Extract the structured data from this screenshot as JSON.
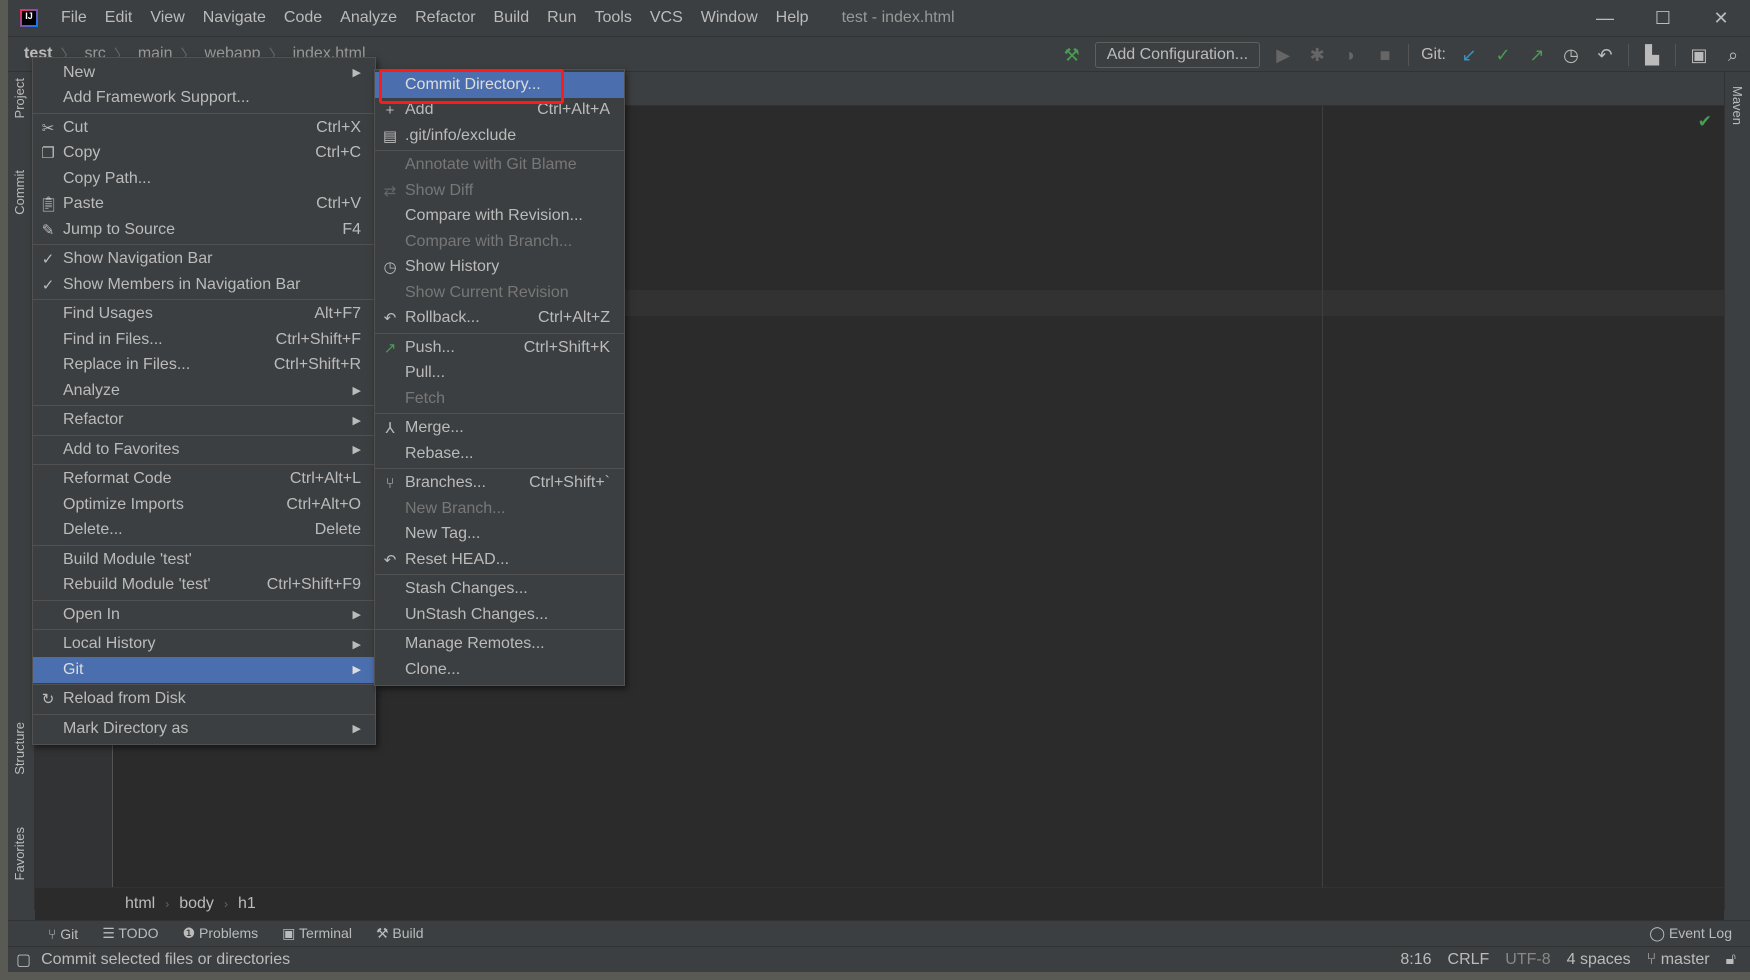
{
  "window": {
    "title": "test - index.html",
    "menu": [
      "File",
      "Edit",
      "View",
      "Navigate",
      "Code",
      "Analyze",
      "Refactor",
      "Build",
      "Run",
      "Tools",
      "VCS",
      "Window",
      "Help"
    ],
    "controls": {
      "minimize": "—",
      "maximize": "☐",
      "close": "✕"
    }
  },
  "navbar": {
    "crumbs": [
      "test",
      "src",
      "main",
      "webapp",
      "index.html"
    ],
    "add_configuration": "Add Configuration...",
    "git_label": "Git:"
  },
  "left_strip": [
    "Project",
    "Commit",
    "Structure",
    "Favorites"
  ],
  "right_strip": [
    "Maven"
  ],
  "editor_breadcrumb": [
    "html",
    "body",
    "h1"
  ],
  "tool_windows": [
    "Git",
    "TODO",
    "Problems",
    "Terminal",
    "Build"
  ],
  "event_log": "Event Log",
  "status": {
    "message": "Commit selected files or directories",
    "position": "8:16",
    "line_sep": "CRLF",
    "encoding": "UTF-8",
    "indent": "4 spaces",
    "branch": "master"
  },
  "context_menu": [
    {
      "label": "New",
      "submenu": true
    },
    {
      "label": "Add Framework Support..."
    },
    {
      "sep": true
    },
    {
      "label": "Cut",
      "shortcut": "Ctrl+X",
      "icon": "scissors"
    },
    {
      "label": "Copy",
      "shortcut": "Ctrl+C",
      "icon": "copy"
    },
    {
      "label": "Copy Path..."
    },
    {
      "label": "Paste",
      "shortcut": "Ctrl+V",
      "icon": "paste"
    },
    {
      "label": "Jump to Source",
      "shortcut": "F4",
      "icon": "pencil"
    },
    {
      "sep": true
    },
    {
      "label": "Show Navigation Bar",
      "icon": "check"
    },
    {
      "label": "Show Members in Navigation Bar",
      "icon": "check"
    },
    {
      "sep": true
    },
    {
      "label": "Find Usages",
      "shortcut": "Alt+F7"
    },
    {
      "label": "Find in Files...",
      "shortcut": "Ctrl+Shift+F"
    },
    {
      "label": "Replace in Files...",
      "shortcut": "Ctrl+Shift+R"
    },
    {
      "label": "Analyze",
      "submenu": true
    },
    {
      "sep": true
    },
    {
      "label": "Refactor",
      "submenu": true
    },
    {
      "sep": true
    },
    {
      "label": "Add to Favorites",
      "submenu": true
    },
    {
      "sep": true
    },
    {
      "label": "Reformat Code",
      "shortcut": "Ctrl+Alt+L"
    },
    {
      "label": "Optimize Imports",
      "shortcut": "Ctrl+Alt+O"
    },
    {
      "label": "Delete...",
      "shortcut": "Delete"
    },
    {
      "sep": true
    },
    {
      "label": "Build Module 'test'"
    },
    {
      "label": "Rebuild Module 'test'",
      "shortcut": "Ctrl+Shift+F9"
    },
    {
      "sep": true
    },
    {
      "label": "Open In",
      "submenu": true
    },
    {
      "sep": true
    },
    {
      "label": "Local History",
      "submenu": true
    },
    {
      "label": "Git",
      "submenu": true,
      "selected": true
    },
    {
      "sep": true
    },
    {
      "label": "Reload from Disk",
      "icon": "reload"
    },
    {
      "sep": true
    },
    {
      "label": "Mark Directory as",
      "submenu": true
    }
  ],
  "git_submenu": [
    {
      "label": "Commit Directory...",
      "selected": true
    },
    {
      "label": "Add",
      "shortcut": "Ctrl+Alt+A",
      "icon": "plus"
    },
    {
      "label": ".git/info/exclude",
      "icon": "file-ignore"
    },
    {
      "sep": true
    },
    {
      "label": "Annotate with Git Blame",
      "disabled": true
    },
    {
      "label": "Show Diff",
      "disabled": true,
      "icon": "diff"
    },
    {
      "label": "Compare with Revision..."
    },
    {
      "label": "Compare with Branch...",
      "disabled": true
    },
    {
      "label": "Show History",
      "icon": "clock"
    },
    {
      "label": "Show Current Revision",
      "disabled": true
    },
    {
      "label": "Rollback...",
      "shortcut": "Ctrl+Alt+Z",
      "icon": "undo"
    },
    {
      "sep": true
    },
    {
      "label": "Push...",
      "shortcut": "Ctrl+Shift+K",
      "icon": "push-arrow"
    },
    {
      "label": "Pull..."
    },
    {
      "label": "Fetch",
      "disabled": true
    },
    {
      "sep": true
    },
    {
      "label": "Merge...",
      "icon": "merge"
    },
    {
      "label": "Rebase..."
    },
    {
      "sep": true
    },
    {
      "label": "Branches...",
      "shortcut": "Ctrl+Shift+`",
      "icon": "branch"
    },
    {
      "label": "New Branch...",
      "disabled": true
    },
    {
      "label": "New Tag..."
    },
    {
      "label": "Reset HEAD...",
      "icon": "undo"
    },
    {
      "sep": true
    },
    {
      "label": "Stash Changes..."
    },
    {
      "label": "UnStash Changes..."
    },
    {
      "sep": true
    },
    {
      "label": "Manage Remotes..."
    },
    {
      "label": "Clone..."
    }
  ],
  "colors": {
    "selection": "#4b6eaf",
    "highlight_box": "#ff1a1a",
    "git_green": "#499c54",
    "git_blue": "#3592c4"
  }
}
